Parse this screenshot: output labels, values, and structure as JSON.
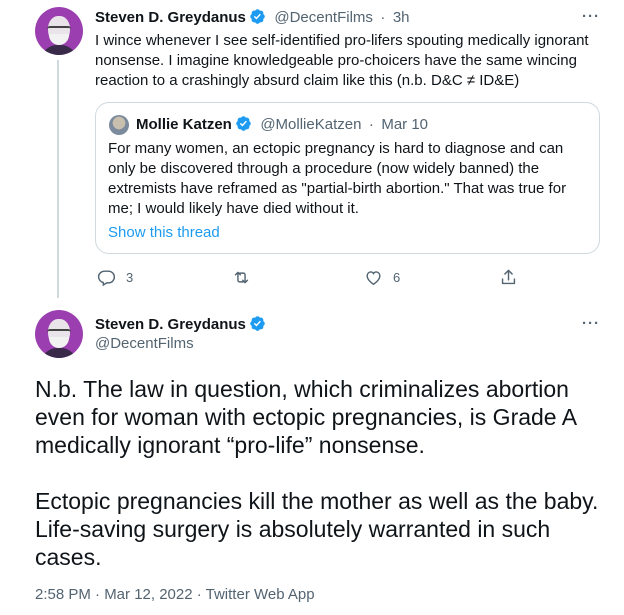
{
  "tweet1": {
    "name": "Steven D. Greydanus",
    "handle": "@DecentFilms",
    "separator": "·",
    "time": "3h",
    "text_lines": [
      "I wince whenever I see self-identified pro-lifers spouting medically ignorant",
      "nonsense. I imagine knowledgeable pro-choicers have the same wincing",
      "reaction to a crashingly absurd claim like this (n.b. D&C ≠ ID&E)"
    ],
    "more": "···",
    "quote": {
      "name": "Mollie Katzen",
      "handle": "@MollieKatzen",
      "separator": "·",
      "date": "Mar 10",
      "text_lines": [
        "For many women, an ectopic pregnancy is hard to diagnose and can",
        "only be discovered through a procedure (now widely banned) the",
        "extremists have reframed as \"partial-birth abortion.\" That was true for",
        "me; I would likely have died without it."
      ],
      "show_thread": "Show this thread"
    },
    "actions": {
      "reply_count": "3",
      "retweet_count": "",
      "like_count": "6"
    }
  },
  "tweet2": {
    "name": "Steven D. Greydanus",
    "handle": "@DecentFilms",
    "more": "···",
    "text_lines": [
      "N.b. The law in question, which criminalizes abortion",
      "even for woman with ectopic pregnancies, is Grade A",
      "medically ignorant “pro-life” nonsense.",
      "",
      "Ectopic pregnancies kill the mother as well as the baby.",
      "Life-saving surgery is absolutely warranted in such",
      "cases."
    ],
    "timestamp": "2:58 PM · Mar 12, 2022 · Twitter Web App"
  },
  "colors": {
    "accent": "#1d9bf0",
    "muted": "#536471",
    "border": "#cfd9de"
  },
  "icons": [
    "verified-badge-icon",
    "reply-icon",
    "retweet-icon",
    "like-icon",
    "share-icon",
    "more-icon"
  ]
}
